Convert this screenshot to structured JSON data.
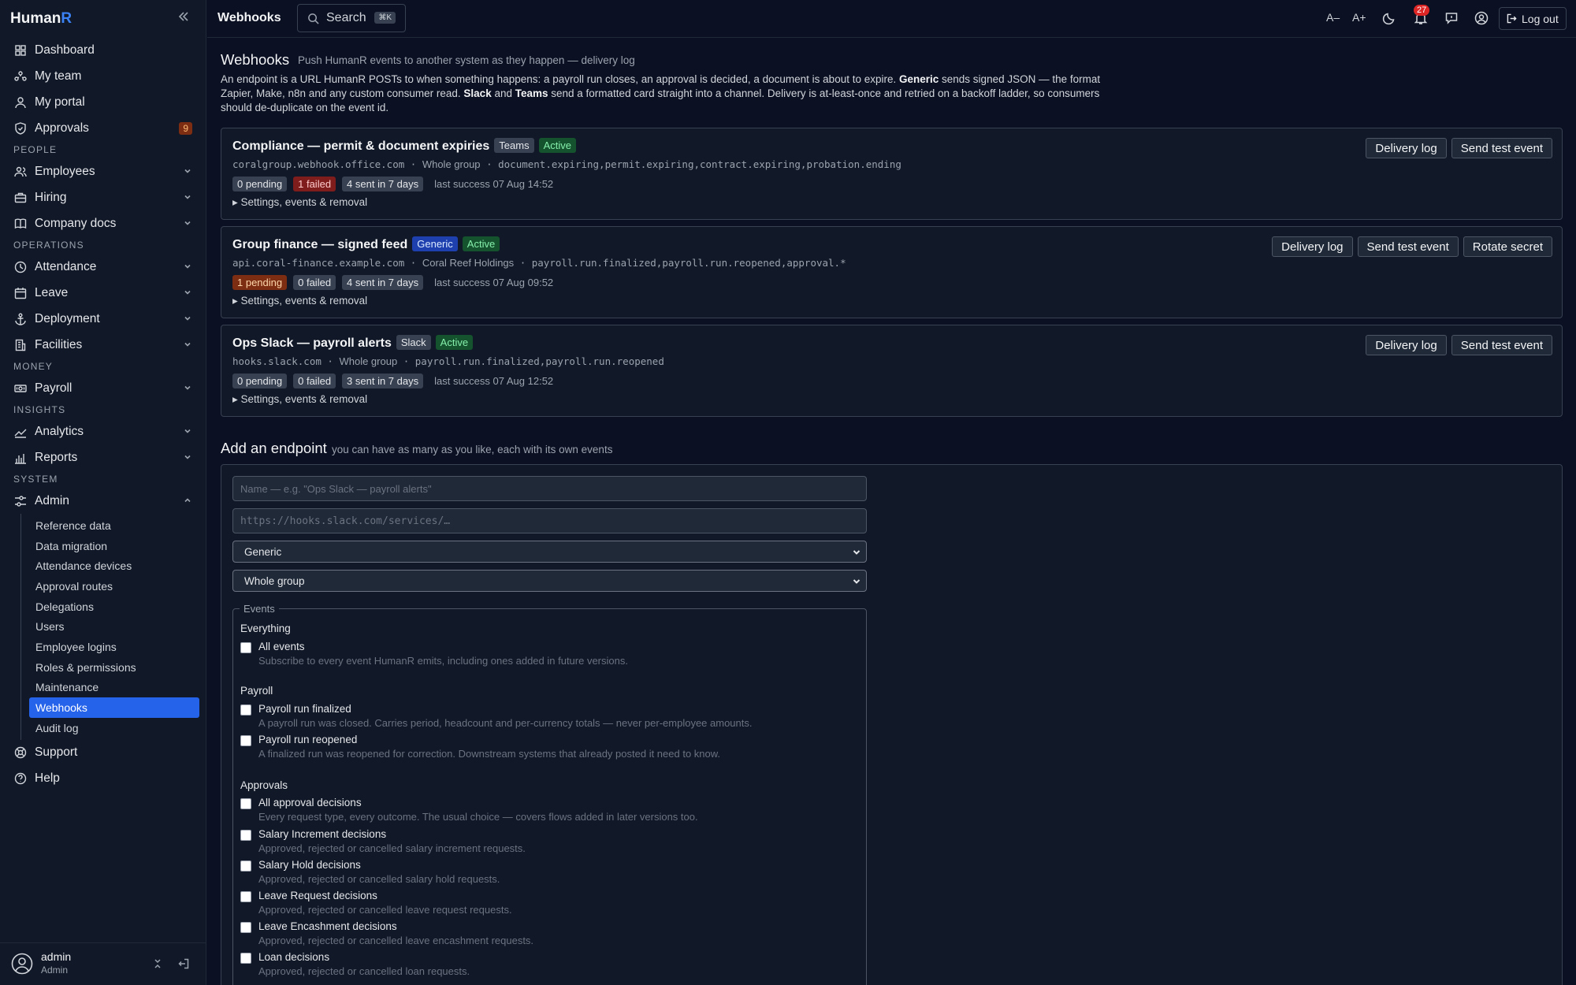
{
  "brand": {
    "name_a": "Human",
    "name_b": "R"
  },
  "sidebar": {
    "items_top": [
      {
        "label": "Dashboard",
        "icon": "dashboard-icon"
      },
      {
        "label": "My team",
        "icon": "team-icon"
      },
      {
        "label": "My portal",
        "icon": "user-icon"
      },
      {
        "label": "Approvals",
        "icon": "shield-icon",
        "badge": "9"
      }
    ],
    "sections": [
      {
        "label": "PEOPLE",
        "items": [
          {
            "label": "Employees",
            "icon": "users-icon"
          },
          {
            "label": "Hiring",
            "icon": "briefcase-icon"
          },
          {
            "label": "Company docs",
            "icon": "book-icon"
          }
        ]
      },
      {
        "label": "OPERATIONS",
        "items": [
          {
            "label": "Attendance",
            "icon": "clock-icon"
          },
          {
            "label": "Leave",
            "icon": "calendar-icon"
          },
          {
            "label": "Deployment",
            "icon": "anchor-icon"
          },
          {
            "label": "Facilities",
            "icon": "building-icon"
          }
        ]
      },
      {
        "label": "MONEY",
        "items": [
          {
            "label": "Payroll",
            "icon": "money-icon"
          }
        ]
      },
      {
        "label": "INSIGHTS",
        "items": [
          {
            "label": "Analytics",
            "icon": "trend-icon"
          },
          {
            "label": "Reports",
            "icon": "bar-chart-icon"
          }
        ]
      },
      {
        "label": "SYSTEM",
        "items": [
          {
            "label": "Admin",
            "icon": "sliders-icon"
          }
        ]
      }
    ],
    "admin_sub": [
      "Reference data",
      "Data migration",
      "Attendance devices",
      "Approval routes",
      "Delegations",
      "Users",
      "Employee logins",
      "Roles & permissions",
      "Maintenance",
      "Webhooks",
      "Audit log"
    ],
    "items_bottom": [
      {
        "label": "Support",
        "icon": "lifebuoy-icon"
      },
      {
        "label": "Help",
        "icon": "help-icon"
      }
    ],
    "user": {
      "name": "admin",
      "role": "Admin"
    }
  },
  "topbar": {
    "title": "Webhooks",
    "search_label": "Search",
    "search_kbd": "⌘K",
    "font_dec": "A–",
    "font_inc": "A+",
    "notifications": "27",
    "logout": "Log out"
  },
  "page": {
    "title": "Webhooks",
    "subtitle": "Push HumanR events to another system as they happen — delivery log",
    "intro": {
      "p1": "An endpoint is a URL HumanR POSTs to when something happens: a payroll run closes, an approval is decided, a document is about to expire. ",
      "b1": "Generic",
      "p2": " sends signed JSON — the format Zapier, Make, n8n and any custom consumer read. ",
      "b2": "Slack",
      "p3": " and ",
      "b3": "Teams",
      "p4": " send a formatted card straight into a channel. Delivery is at-least-once and retried on a backoff ladder, so consumers should de-duplicate on the event id."
    }
  },
  "endpoints": [
    {
      "name": "Compliance — permit & document expiries",
      "kind": "Teams",
      "status": "Active",
      "host": "coralgroup.webhook.office.com",
      "scope": "Whole group",
      "events": "document.expiring,permit.expiring,contract.expiring,probation.ending",
      "pending": "0 pending",
      "failed": "1 failed",
      "sent": "4 sent in 7 days",
      "last_success": "last success 07 Aug 14:52",
      "details": "▸ Settings, events & removal",
      "buttons": [
        "Delivery log",
        "Send test event"
      ]
    },
    {
      "name": "Group finance — signed feed",
      "kind": "Generic",
      "status": "Active",
      "host": "api.coral-finance.example.com",
      "scope": "Coral Reef Holdings",
      "events": "payroll.run.finalized,payroll.run.reopened,approval.*",
      "pending": "1 pending",
      "failed": "0 failed",
      "sent": "4 sent in 7 days",
      "last_success": "last success 07 Aug 09:52",
      "details": "▸ Settings, events & removal",
      "buttons": [
        "Delivery log",
        "Send test event",
        "Rotate secret"
      ]
    },
    {
      "name": "Ops Slack — payroll alerts",
      "kind": "Slack",
      "status": "Active",
      "host": "hooks.slack.com",
      "scope": "Whole group",
      "events": "payroll.run.finalized,payroll.run.reopened",
      "pending": "0 pending",
      "failed": "0 failed",
      "sent": "3 sent in 7 days",
      "last_success": "last success 07 Aug 12:52",
      "details": "▸ Settings, events & removal",
      "buttons": [
        "Delivery log",
        "Send test event"
      ]
    }
  ],
  "add_form": {
    "title": "Add an endpoint",
    "subtitle": "you can have as many as you like, each with its own events",
    "name_placeholder": "Name — e.g. \"Ops Slack — payroll alerts\"",
    "url_placeholder": "https://hooks.slack.com/services/…",
    "kind_selected": "Generic",
    "scope_selected": "Whole group",
    "events_legend": "Events",
    "groups": [
      {
        "title": "Everything",
        "options": [
          {
            "label": "All events",
            "desc": "Subscribe to every event HumanR emits, including ones added in future versions."
          }
        ]
      },
      {
        "title": "Payroll",
        "options": [
          {
            "label": "Payroll run finalized",
            "desc": "A payroll run was closed. Carries period, headcount and per-currency totals — never per-employee amounts."
          },
          {
            "label": "Payroll run reopened",
            "desc": "A finalized run was reopened for correction. Downstream systems that already posted it need to know."
          }
        ]
      },
      {
        "title": "Approvals",
        "options": [
          {
            "label": "All approval decisions",
            "desc": "Every request type, every outcome. The usual choice — covers flows added in later versions too."
          },
          {
            "label": "Salary Increment decisions",
            "desc": "Approved, rejected or cancelled salary increment requests."
          },
          {
            "label": "Salary Hold decisions",
            "desc": "Approved, rejected or cancelled salary hold requests."
          },
          {
            "label": "Leave Request decisions",
            "desc": "Approved, rejected or cancelled leave request requests."
          },
          {
            "label": "Leave Encashment decisions",
            "desc": "Approved, rejected or cancelled leave encashment requests."
          },
          {
            "label": "Loan decisions",
            "desc": "Approved, rejected or cancelled loan requests."
          }
        ]
      }
    ]
  }
}
